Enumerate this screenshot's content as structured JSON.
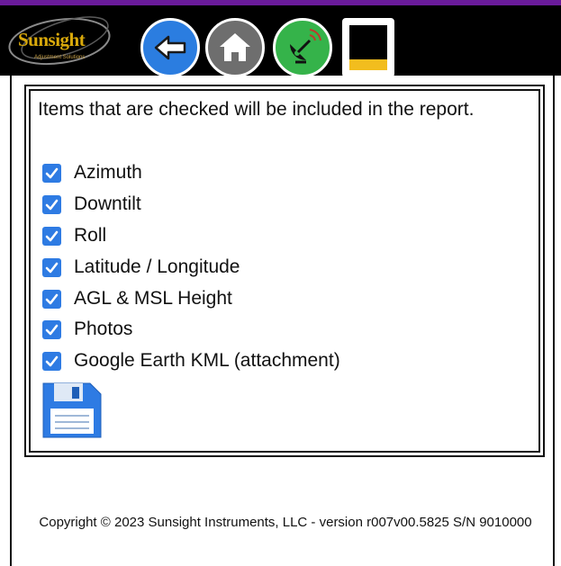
{
  "header": {
    "logo": {
      "brand": "Sunsight",
      "tagline": "Adjustment Solutions"
    },
    "buttons": [
      {
        "name": "back",
        "icon": "arrow-left-icon",
        "color": "#2b7de0"
      },
      {
        "name": "home",
        "icon": "home-icon",
        "color": "#6e6e6e"
      },
      {
        "name": "gps",
        "icon": "satellite-dish-icon",
        "color": "#35b34a"
      }
    ],
    "battery": {
      "icon": "battery-icon",
      "level": 0.25,
      "fill_color": "#f2bd1e"
    }
  },
  "report": {
    "intro": "Items that are checked will be included in the report.",
    "items": [
      {
        "label": "Azimuth",
        "checked": true
      },
      {
        "label": "Downtilt",
        "checked": true
      },
      {
        "label": "Roll",
        "checked": true
      },
      {
        "label": "Latitude / Longitude",
        "checked": true
      },
      {
        "label": "AGL & MSL Height",
        "checked": true
      },
      {
        "label": "Photos",
        "checked": true
      },
      {
        "label": "Google Earth KML (attachment)",
        "checked": true
      }
    ],
    "save_icon": "save-floppy-icon"
  },
  "footer": {
    "copyright": "Copyright © 2023 Sunsight Instruments, LLC - version r007v00.5825 S/N 9010000"
  },
  "colors": {
    "accent": "#2e7be3",
    "topline": "#6a1b9a",
    "header_bg": "#000000"
  }
}
